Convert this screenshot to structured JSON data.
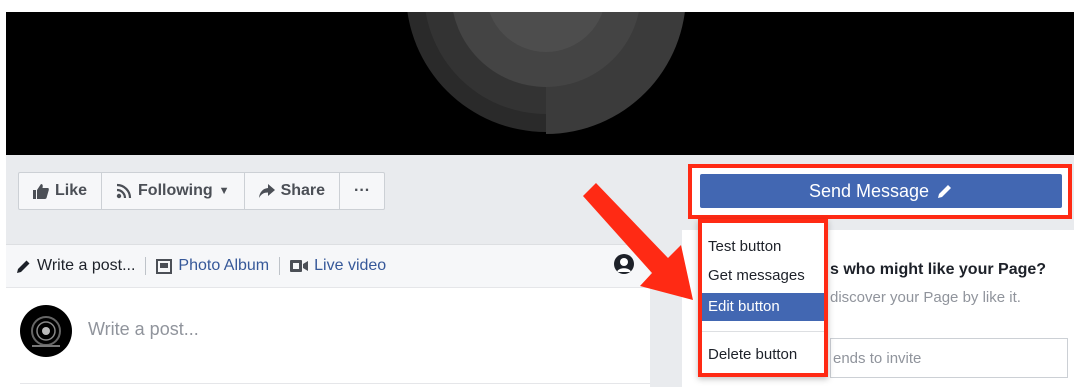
{
  "action_bar": {
    "like_label": "Like",
    "following_label": "Following",
    "share_label": "Share",
    "more_label": "···"
  },
  "composer": {
    "write_post_tab": "Write a post...",
    "photo_album_tab": "Photo Album",
    "live_video_tab": "Live video",
    "placeholder": "Write a post..."
  },
  "send_message": {
    "label": "Send Message"
  },
  "dropdown": {
    "items": [
      "Test button",
      "Get messages",
      "Edit button",
      "Delete button"
    ],
    "active_index": 2
  },
  "side_card": {
    "title": "s who might like your Page?",
    "body": "discover your Page by like it.",
    "invite_placeholder": "ends to invite"
  },
  "colors": {
    "brand_blue": "#4267b2",
    "highlight_red": "#ff2a14",
    "link_blue": "#365899"
  }
}
